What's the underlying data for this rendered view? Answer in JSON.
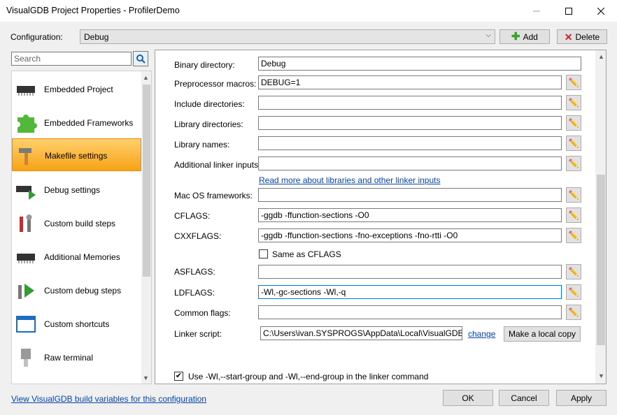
{
  "window": {
    "title": "VisualGDB Project Properties - ProfilerDemo",
    "min_icon": "minimize-icon",
    "max_icon": "maximize-icon",
    "close_icon": "close-icon"
  },
  "config": {
    "label": "Configuration:",
    "value": "Debug",
    "add_label": "Add",
    "delete_label": "Delete"
  },
  "search": {
    "placeholder": "Search"
  },
  "sidebar": {
    "items": [
      {
        "label": "Embedded Project",
        "icon": "chip-icon",
        "selected": false
      },
      {
        "label": "Embedded Frameworks",
        "icon": "puzzle-icon",
        "selected": false
      },
      {
        "label": "Makefile settings",
        "icon": "hammer-icon",
        "selected": true
      },
      {
        "label": "Debug settings",
        "icon": "chip-play-icon",
        "selected": false
      },
      {
        "label": "Custom build steps",
        "icon": "tools-icon",
        "selected": false
      },
      {
        "label": "Additional Memories",
        "icon": "chip-icon",
        "selected": false
      },
      {
        "label": "Custom debug steps",
        "icon": "wrench-play-icon",
        "selected": false
      },
      {
        "label": "Custom shortcuts",
        "icon": "window-icon",
        "selected": false
      },
      {
        "label": "Raw terminal",
        "icon": "connector-icon",
        "selected": false
      }
    ]
  },
  "fields": {
    "binary_directory": {
      "label": "Binary directory:",
      "value": "Debug"
    },
    "preprocessor_macros": {
      "label": "Preprocessor macros:",
      "value": "DEBUG=1"
    },
    "include_directories": {
      "label": "Include directories:",
      "value": ""
    },
    "library_directories": {
      "label": "Library directories:",
      "value": ""
    },
    "library_names": {
      "label": "Library names:",
      "value": ""
    },
    "additional_linker_inputs": {
      "label": "Additional linker inputs:",
      "value": ""
    },
    "read_more_link": "Read more about libraries and other linker inputs",
    "mac_os_frameworks": {
      "label": "Mac OS frameworks:",
      "value": ""
    },
    "cflags": {
      "label": "CFLAGS:",
      "value": "-ggdb -ffunction-sections -O0"
    },
    "cxxflags": {
      "label": "CXXFLAGS:",
      "value": "-ggdb -ffunction-sections -fno-exceptions -fno-rtti -O0"
    },
    "same_as_cflags": {
      "label": "Same as CFLAGS",
      "checked": false
    },
    "asflags": {
      "label": "ASFLAGS:",
      "value": ""
    },
    "ldflags": {
      "label": "LDFLAGS:",
      "value": "-Wl,-gc-sections -Wl,-q"
    },
    "common_flags": {
      "label": "Common flags:",
      "value": ""
    },
    "linker_script": {
      "label": "Linker script:",
      "value": "C:\\Users\\ivan.SYSPROGS\\AppData\\Local\\VisualGDB\\Em",
      "change_label": "change",
      "local_copy_label": "Make a local copy"
    },
    "use_group": {
      "label": "Use -Wl,--start-group and -Wl,--end-group in the linker command",
      "checked": true
    }
  },
  "footer": {
    "link": "View VisualGDB build variables for this configuration",
    "ok": "OK",
    "cancel": "Cancel",
    "apply": "Apply"
  },
  "colors": {
    "selection": "#f7a317",
    "link": "#0645ad",
    "focus_border": "#0078d7"
  }
}
